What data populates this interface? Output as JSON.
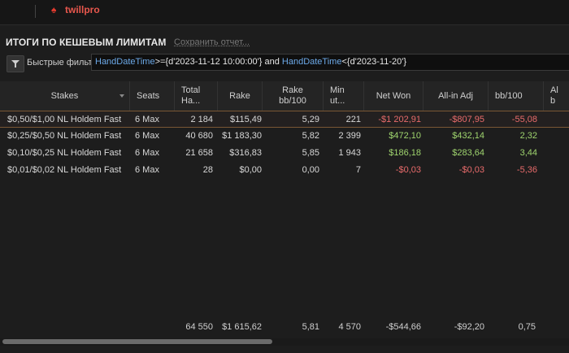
{
  "app": {
    "brand": "twillpro"
  },
  "report": {
    "title": "ИТОГИ ПО КЕШЕВЫМ ЛИМИТАМ",
    "save_link": "Сохранить отчет..."
  },
  "filter": {
    "label": "Быстрые фильт",
    "kw1": "HandDateTime",
    "op1": ">={d'2023-11-12 10:00:00'} and ",
    "kw2": "HandDateTime",
    "op2": "<{d'2023-11-20'}"
  },
  "columns": {
    "stakes": "Stakes",
    "seats": "Seats",
    "total_hands_1": "Total",
    "total_hands_2": "Ha...",
    "rake": "Rake",
    "rake_bb_1": "Rake",
    "rake_bb_2": "bb/100",
    "minutes_1": "Min",
    "minutes_2": "ut...",
    "net_won": "Net Won",
    "allin_adj": "All-in Adj",
    "bb100": "bb/100",
    "allin_bb_1": "Al",
    "allin_bb_2": "b"
  },
  "rows": [
    {
      "stakes": "$0,50/$1,00 NL Holdem Fast",
      "seats": "6 Max",
      "hands": "2 184",
      "rake": "$115,49",
      "rake_bb": "5,29",
      "minutes": "221",
      "net_won": "-$1 202,91",
      "allin_adj": "-$807,95",
      "bb100": "-55,08"
    },
    {
      "stakes": "$0,25/$0,50 NL Holdem Fast",
      "seats": "6 Max",
      "hands": "40 680",
      "rake": "$1 183,30",
      "rake_bb": "5,82",
      "minutes": "2 399",
      "net_won": "$472,10",
      "allin_adj": "$432,14",
      "bb100": "2,32"
    },
    {
      "stakes": "$0,10/$0,25 NL Holdem Fast",
      "seats": "6 Max",
      "hands": "21 658",
      "rake": "$316,83",
      "rake_bb": "5,85",
      "minutes": "1 943",
      "net_won": "$186,18",
      "allin_adj": "$283,64",
      "bb100": "3,44"
    },
    {
      "stakes": "$0,01/$0,02 NL Holdem Fast",
      "seats": "6 Max",
      "hands": "28",
      "rake": "$0,00",
      "rake_bb": "0,00",
      "minutes": "7",
      "net_won": "-$0,03",
      "allin_adj": "-$0,03",
      "bb100": "-5,36"
    }
  ],
  "totals": {
    "hands": "64 550",
    "rake": "$1 615,62",
    "rake_bb": "5,81",
    "minutes": "4 570",
    "net_won": "-$544,66",
    "allin_adj": "-$92,20",
    "bb100": "0,75"
  },
  "colors": {
    "positive": "#9fd46e",
    "negative": "#e86b6b",
    "accent": "#e8574d",
    "keyword": "#6ca9e8"
  }
}
